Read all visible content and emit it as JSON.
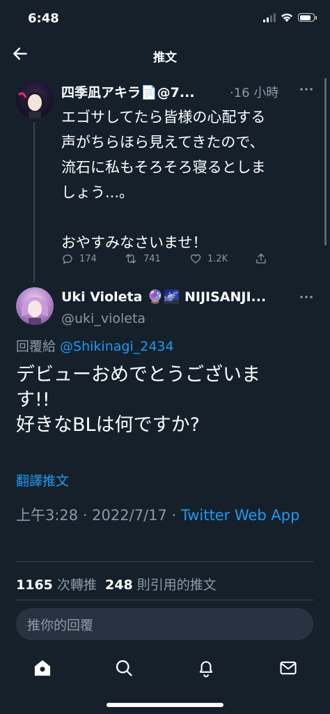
{
  "status": {
    "time": "6:48"
  },
  "header": {
    "title": "推文"
  },
  "tweet1": {
    "display_name": "四季凪アキラ📄@7...",
    "time": "·16 小時",
    "lines": [
      "エゴサしてたら皆様の心配する",
      "声がちらほら見えてきたので、",
      "流石に私もそろそろ寝るとしま",
      "しょう...。",
      "",
      "おやすみなさいませ！"
    ],
    "replies": "174",
    "retweets": "741",
    "likes": "1.2K"
  },
  "tweet2": {
    "display_name": "Uki Violeta 🔮🌌 NIJISANJI...",
    "handle": "@uki_violeta",
    "reply_prefix": "回覆給 ",
    "reply_handle": "@Shikinagi_2434",
    "lines": [
      "デビューおめでとうございま",
      "す!!",
      "好きなBLは何ですか?"
    ],
    "translate": "翻譯推文",
    "datetime": "上午3:28 · 2022/7/17 · ",
    "source": "Twitter Web App",
    "retweet_count": "1165",
    "retweet_label": " 次轉推  ",
    "quote_count": "248",
    "quote_label": " 則引用的推文"
  },
  "composer": {
    "placeholder": "推你的回覆"
  },
  "icons": {
    "back": "arrow-left-icon",
    "more": "more-icon",
    "reply": "reply-icon",
    "retweet": "retweet-icon",
    "like": "heart-icon",
    "share": "share-icon",
    "home": "home-icon",
    "search": "search-icon",
    "notifications": "bell-icon",
    "messages": "mail-icon"
  },
  "colors": {
    "background": "#15202b",
    "accent": "#1d9bf0",
    "muted": "#8b98a5",
    "divider": "#38444d"
  }
}
